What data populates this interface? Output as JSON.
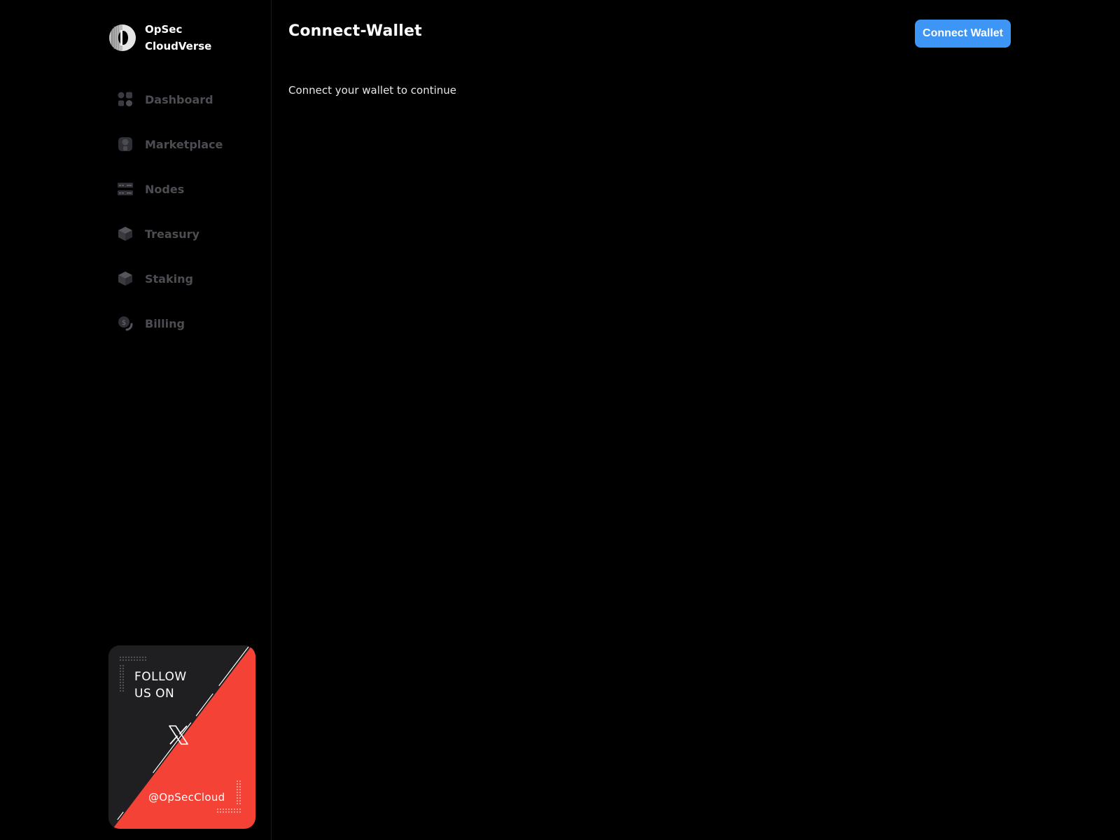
{
  "brand": {
    "name_line1": "OpSec",
    "name_line2": "CloudVerse",
    "logo_icon": "opsec-logo"
  },
  "sidebar": {
    "items": [
      {
        "label": "Dashboard",
        "icon": "dashboard-icon"
      },
      {
        "label": "Marketplace",
        "icon": "marketplace-icon"
      },
      {
        "label": "Nodes",
        "icon": "nodes-icon"
      },
      {
        "label": "Treasury",
        "icon": "treasury-icon"
      },
      {
        "label": "Staking",
        "icon": "staking-icon"
      },
      {
        "label": "Billing",
        "icon": "billing-icon"
      }
    ]
  },
  "promo": {
    "title_line1": "FOLLOW",
    "title_line2": "US ON",
    "platform_icon": "x-logo-icon",
    "handle": "@OpSecCloud"
  },
  "main": {
    "title": "Connect-Wallet",
    "connect_button_label": "Connect Wallet",
    "prompt": "Connect your wallet to continue"
  },
  "colors": {
    "background": "#000000",
    "accent": "#3d95f5",
    "promo_red": "#f44336",
    "promo_dark": "#1f1f22",
    "nav_inactive": "#4c4d52"
  }
}
